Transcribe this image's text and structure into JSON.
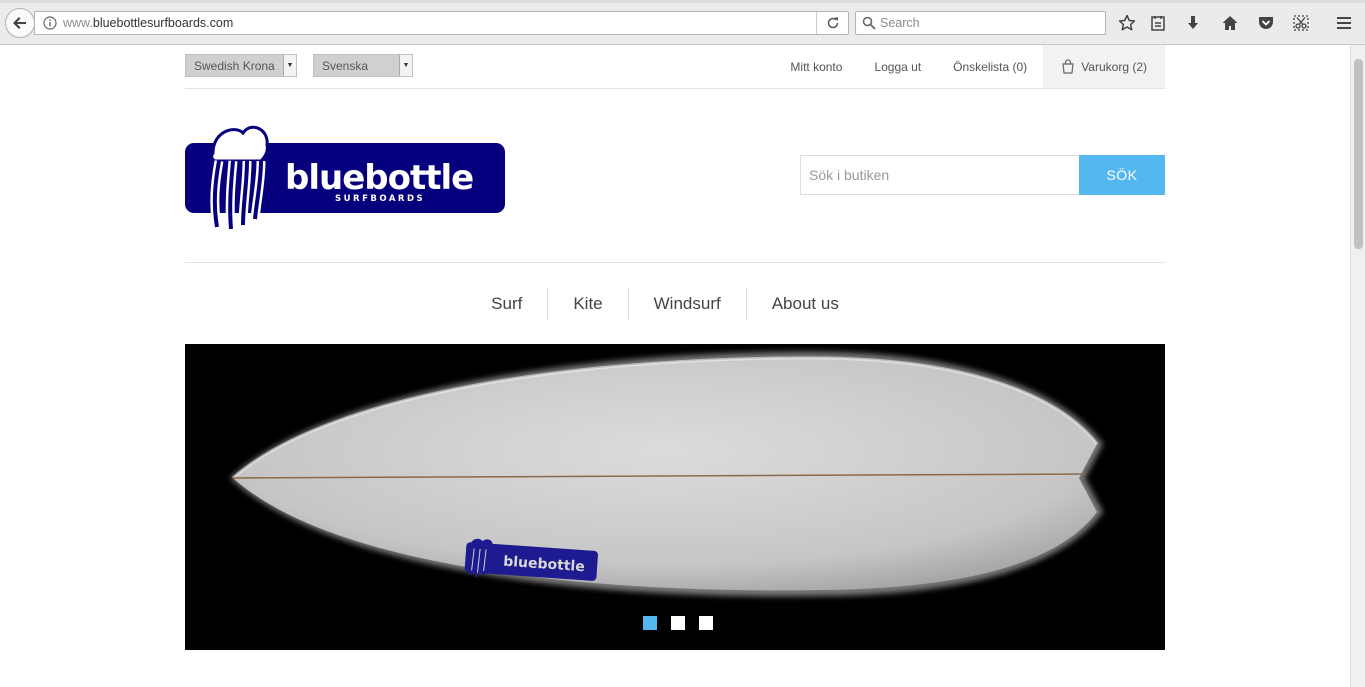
{
  "browser": {
    "url_dim": "www.",
    "url_main": "bluebottlesurfboards.com",
    "search_placeholder": "Search"
  },
  "topbar": {
    "currency": "Swedish Krona",
    "language": "Svenska",
    "links": {
      "account": "Mitt konto",
      "logout": "Logga ut",
      "wishlist": "Önskelista (0)",
      "cart": "Varukorg (2)"
    }
  },
  "header": {
    "logo_text": "bluebottle",
    "logo_sub": "SURFBOARDS",
    "search_placeholder": "Sök i butiken",
    "search_button": "SÖK"
  },
  "nav": {
    "items": [
      "Surf",
      "Kite",
      "Windsurf",
      "About us"
    ]
  },
  "banner": {
    "board_logo_text": "bluebottle",
    "slides": 3,
    "active_slide": 1
  },
  "colors": {
    "brand_blue": "#06007f",
    "accent": "#55b7ef"
  }
}
